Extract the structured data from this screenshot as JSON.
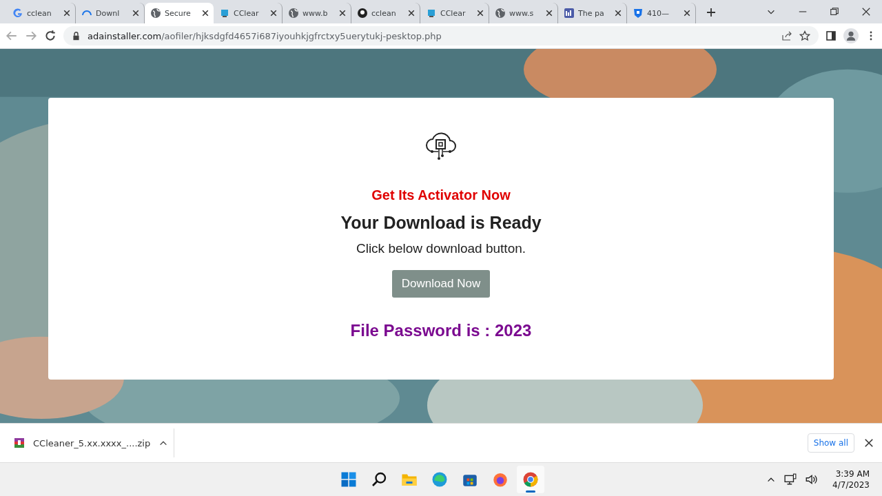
{
  "tabs": [
    {
      "kind": "google",
      "title": "cclean",
      "selected": false
    },
    {
      "kind": "loading",
      "title": "Downl",
      "selected": false
    },
    {
      "kind": "globe",
      "title": "Secure",
      "selected": true
    },
    {
      "kind": "app",
      "title": "CClear",
      "selected": false
    },
    {
      "kind": "globe",
      "title": "www.b",
      "selected": false
    },
    {
      "kind": "github",
      "title": "cclean",
      "selected": false
    },
    {
      "kind": "app",
      "title": "CClear",
      "selected": false
    },
    {
      "kind": "globe",
      "title": "www.s",
      "selected": false
    },
    {
      "kind": "chart",
      "title": "The pa",
      "selected": false
    },
    {
      "kind": "shield",
      "title": "410—",
      "selected": false
    }
  ],
  "address_bar": {
    "domain": "adainstaller.com",
    "path": "/aofiler/hjksdgfd4657i687iyouhkjgfrctxy5uerytukj-pesktop.php"
  },
  "page": {
    "promo": "Get Its Activator Now",
    "heading": "Your Download is Ready",
    "subtext": "Click below download button.",
    "button": "Download Now",
    "password": "File Password is : 2023"
  },
  "download_bar": {
    "file": "CCleaner_5.xx.xxxx_....zip",
    "show_all": "Show all"
  },
  "taskbar": {
    "apps": [
      {
        "kind": "start",
        "active": false
      },
      {
        "kind": "search",
        "active": false
      },
      {
        "kind": "folder",
        "active": false
      },
      {
        "kind": "edge",
        "active": false
      },
      {
        "kind": "store",
        "active": false
      },
      {
        "kind": "firefox",
        "active": false
      },
      {
        "kind": "chrome",
        "active": true
      }
    ],
    "time": "3:39 AM",
    "date": "4/7/2023"
  }
}
